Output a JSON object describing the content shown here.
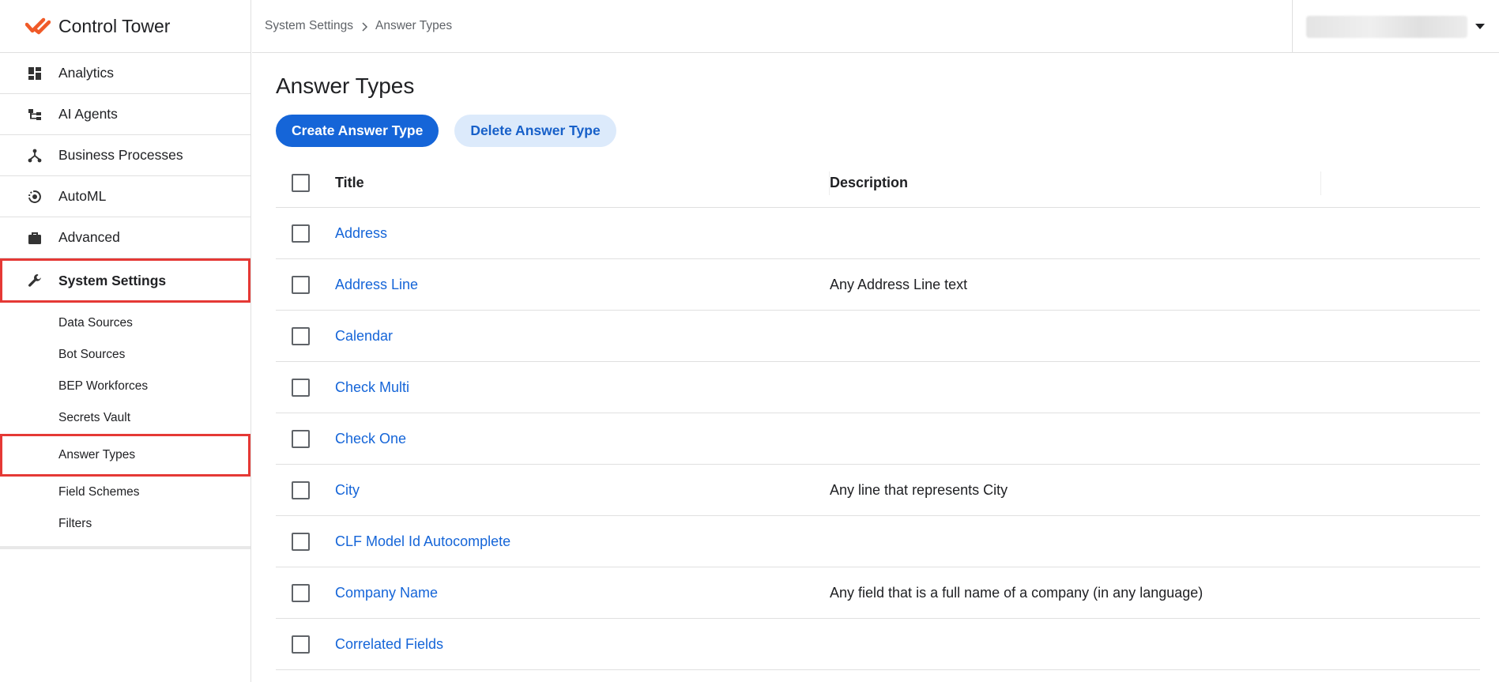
{
  "app": {
    "title": "Control Tower",
    "accent": "#1565d8",
    "logo_color": "#f05a28",
    "highlight_color": "#e53935"
  },
  "sidebar": {
    "items": [
      {
        "label": "Analytics",
        "icon": "dashboard-icon"
      },
      {
        "label": "AI Agents",
        "icon": "hierarchy-icon"
      },
      {
        "label": "Business Processes",
        "icon": "process-icon"
      },
      {
        "label": "AutoML",
        "icon": "automl-icon"
      },
      {
        "label": "Advanced",
        "icon": "briefcase-icon"
      },
      {
        "label": "System Settings",
        "icon": "wrench-icon",
        "active": true
      }
    ],
    "sub_items": [
      {
        "label": "Data Sources"
      },
      {
        "label": "Bot Sources"
      },
      {
        "label": "BEP Workforces"
      },
      {
        "label": "Secrets Vault"
      },
      {
        "label": "Answer Types",
        "active": true
      },
      {
        "label": "Field Schemes"
      },
      {
        "label": "Filters"
      }
    ]
  },
  "breadcrumb": {
    "items": [
      "System Settings",
      "Answer Types"
    ]
  },
  "main": {
    "title": "Answer Types",
    "create_label": "Create Answer Type",
    "delete_label": "Delete Answer Type"
  },
  "table": {
    "columns": [
      "Title",
      "Description"
    ],
    "rows": [
      {
        "title": "Address",
        "description": ""
      },
      {
        "title": "Address Line",
        "description": "Any Address Line text"
      },
      {
        "title": "Calendar",
        "description": ""
      },
      {
        "title": "Check Multi",
        "description": ""
      },
      {
        "title": "Check One",
        "description": ""
      },
      {
        "title": "City",
        "description": "Any line that represents City"
      },
      {
        "title": "CLF Model Id Autocomplete",
        "description": ""
      },
      {
        "title": "Company Name",
        "description": "Any field that is a full name of a company (in any language)"
      },
      {
        "title": "Correlated Fields",
        "description": ""
      }
    ]
  }
}
